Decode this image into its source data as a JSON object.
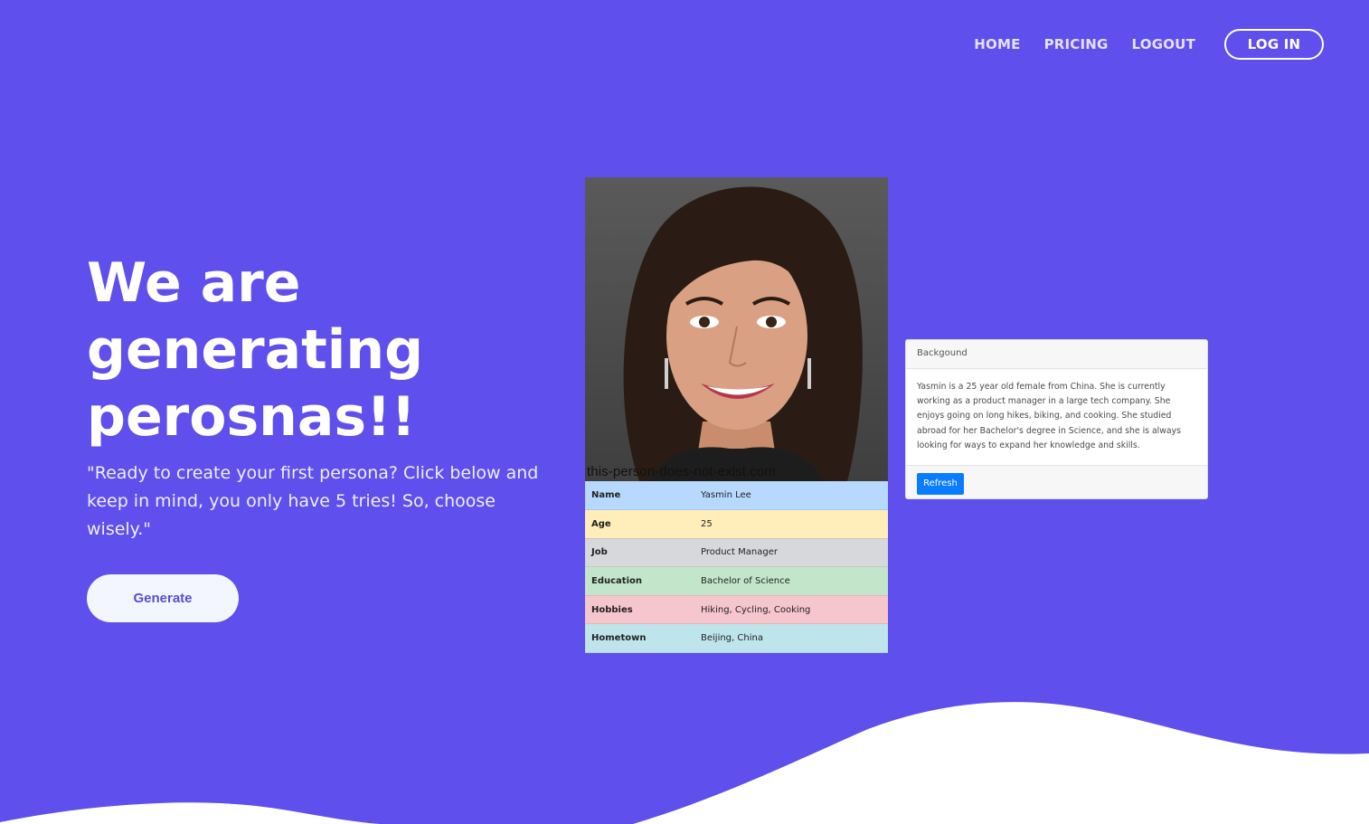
{
  "nav": {
    "items": [
      "HOME",
      "PRICING",
      "LOGOUT"
    ],
    "login_label": "LOG IN"
  },
  "hero": {
    "title": "We are generating perosnas!!",
    "subtitle": "\"Ready to create your first persona? Click below and keep in mind, you only have 5 tries! So, choose wisely.\"",
    "generate_label": "Generate"
  },
  "persona": {
    "watermark": "this-person-does-not-exist.com",
    "rows": [
      {
        "key": "Name",
        "value": "Yasmin Lee"
      },
      {
        "key": "Age",
        "value": "25"
      },
      {
        "key": "Job",
        "value": "Product Manager"
      },
      {
        "key": "Education",
        "value": "Bachelor of Science"
      },
      {
        "key": "Hobbies",
        "value": "Hiking, Cycling, Cooking"
      },
      {
        "key": "Hometown",
        "value": "Beijing, China"
      }
    ]
  },
  "background_card": {
    "header": "Backgound",
    "body": "Yasmin is a 25 year old female from China. She is currently working as a product manager in a large tech company. She enjoys going on long hikes, biking, and cooking. She studied abroad for her Bachelor's degree in Science, and she is always looking for ways to expand her knowledge and skills.",
    "refresh_label": "Refresh"
  },
  "colors": {
    "background": "#5f4fec",
    "accent_button": "#0a7cff",
    "generate_text": "#5b4bd6"
  }
}
